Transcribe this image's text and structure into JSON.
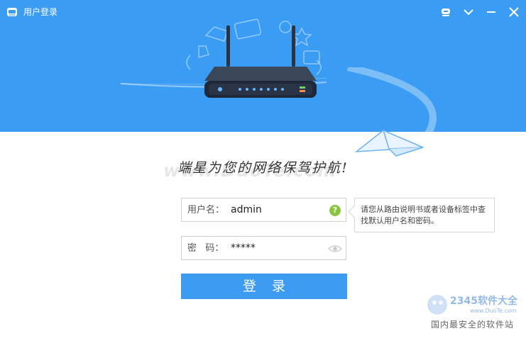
{
  "window": {
    "title": "用户登录",
    "controls": [
      "skin-icon",
      "chevron-down-icon",
      "minimize-icon",
      "close-icon"
    ]
  },
  "slogan": "端星为您的网络保驾护航!",
  "watermark": "www.DuoTe.com",
  "form": {
    "username_label": "用户名：",
    "username_value": "admin",
    "password_label": "密   码：",
    "password_value": "*****",
    "help_glyph": "?",
    "login_label": "登录"
  },
  "tooltip": {
    "text": "请您从路由说明书或者设备标签中查找默认用户名和密码。"
  },
  "brand": {
    "logo_text": "2345软件大全",
    "url": "www.DuoTe.com",
    "slogan": "国内最安全的软件站"
  },
  "colors": {
    "header_bg": "#3a9cf3",
    "button_bg": "#3d9cf2",
    "help_green": "#8cc63f"
  }
}
